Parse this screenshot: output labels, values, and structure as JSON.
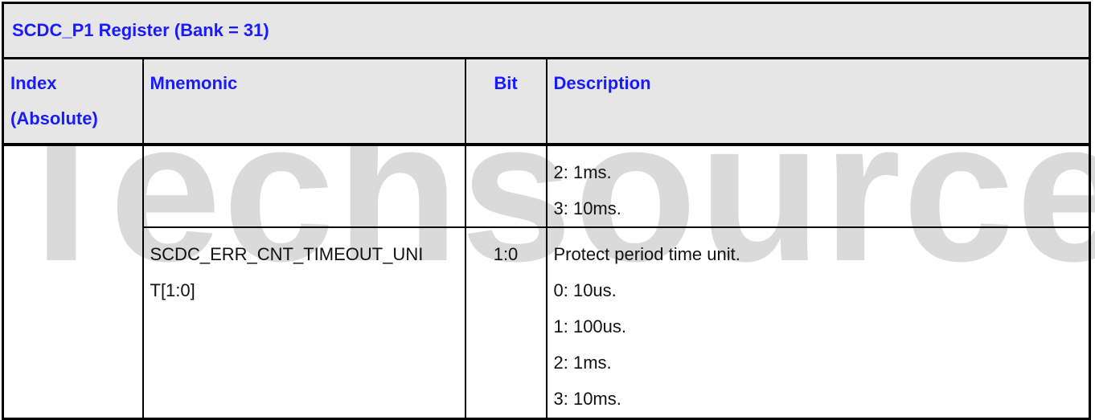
{
  "watermark": "Techsource",
  "table": {
    "title": "SCDC_P1 Register (Bank = 31)",
    "headers": {
      "index_line1": "Index",
      "index_line2": "(Absolute)",
      "mnemonic": "Mnemonic",
      "bit": "Bit",
      "description": "Description"
    },
    "rows": [
      {
        "index": "",
        "mnemonic_line1": "",
        "mnemonic_line2": "",
        "bit": "",
        "description": [
          "2: 1ms.",
          "3: 10ms."
        ]
      },
      {
        "index": "",
        "mnemonic_line1": "SCDC_ERR_CNT_TIMEOUT_UNI",
        "mnemonic_line2": "T[1:0]",
        "bit": "1:0",
        "description": [
          "Protect period time unit.",
          "0: 10us.",
          "1: 100us.",
          "2: 1ms.",
          "3: 10ms."
        ]
      }
    ]
  },
  "colors": {
    "header_text": "#1a1aff",
    "header_bg": "#e6e6e6",
    "watermark": "#dadada"
  }
}
